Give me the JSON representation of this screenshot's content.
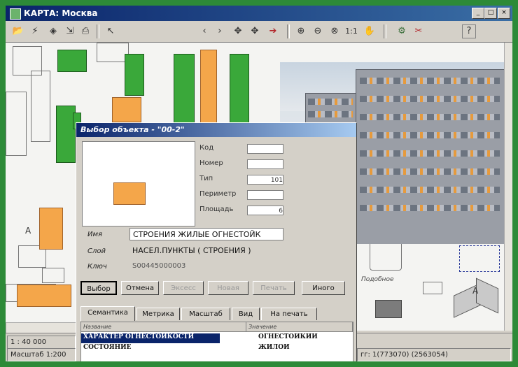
{
  "window": {
    "title": "КАРТА: Москва",
    "controls": {
      "minimize": "_",
      "maximize": "□",
      "close": "×"
    }
  },
  "toolbar": {
    "icons": [
      "open-folder-icon",
      "lightning-icon",
      "layers-icon",
      "export-icon",
      "print-icon",
      "select-cursor-icon",
      "back-icon",
      "forward-icon",
      "pan-icon",
      "pan-alt-icon",
      "route-icon",
      "zoom-in-icon",
      "zoom-out-icon",
      "zoom-area-icon",
      "zoom-actual-icon",
      "hand-icon",
      "settings-icon",
      "tools-icon",
      "help-icon"
    ],
    "glyphs": [
      "📂",
      "⚡",
      "◈",
      "⇲",
      "⎙",
      "↖",
      "‹",
      "›",
      "✥",
      "✥",
      "➔",
      "⊕",
      "⊖",
      "⊗",
      "1:1",
      "✋",
      "⚙",
      "✂",
      "?"
    ],
    "actual_size_label": "1:1"
  },
  "dialog": {
    "title": "Выбор объекта - \"00-2\"",
    "props": [
      {
        "label": "Код",
        "value": ""
      },
      {
        "label": "Номер",
        "value": ""
      },
      {
        "label": "Тип",
        "value": "101"
      },
      {
        "label": "Периметр",
        "value": ""
      },
      {
        "label": "Площадь",
        "value": "6"
      }
    ],
    "fields": [
      {
        "label": "Имя",
        "value": "СТРОЕНИЯ ЖИЛЫЕ ОГНЕСТОЙК"
      },
      {
        "label": "Слой",
        "value": "НАСЕЛ.ПУНКТЫ ( СТРОЕНИЯ )"
      },
      {
        "label": "Ключ",
        "value": "S00445000003"
      }
    ],
    "buttons": [
      "Выбор",
      "Отмена",
      "Эксесс",
      "Новая",
      "Печать",
      "Иного"
    ],
    "tabs": [
      "Семантика",
      "Метрика",
      "Масштаб",
      "Вид",
      "На печать"
    ],
    "table": {
      "headers": [
        "Название",
        "Значение"
      ],
      "rows": [
        [
          "ХАРАКТЕР ОГНЕСТОЙКОСТИ",
          "ОГНЕСТОЙКИЙ"
        ],
        [
          "СОСТОЯНИЕ",
          "ЖИЛОЙ"
        ]
      ]
    }
  },
  "map": {
    "building_label": "А",
    "right_label": "Подобное"
  },
  "status": {
    "scale": "1 : 40 000",
    "scale_bottom": "Масштаб 1:200",
    "coords": "гг: 1(773070) (2563054)"
  },
  "colors": {
    "accent_green": "#2d8a38",
    "map_green": "#3aa83a",
    "building_orange": "#f4a64a",
    "title_blue": "#0a246a"
  }
}
